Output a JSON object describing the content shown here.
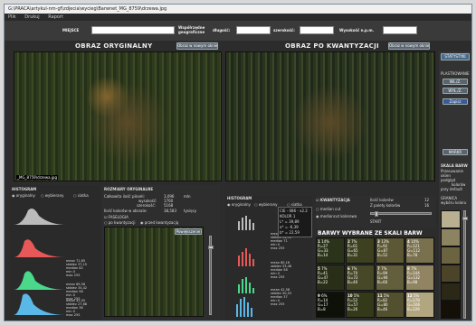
{
  "titlebar": {
    "path": "G:\\PRACA\\artykul-nm-gf\\zdjecia\\wycieg\\Barwnet_MG_8759\\drzewa.jpg"
  },
  "menu": [
    "Plik",
    "Drukuj",
    "Raport"
  ],
  "fields": {
    "miejsce_label": "MIEJSCE",
    "wsp_label": "Współrzędne geograficzne",
    "dlugosc_label": "długość:",
    "szerokosc_label": "szerokość:",
    "wysokosc_label": "Wysokość n.p.m."
  },
  "headers": {
    "original": "OBRAZ ORYGINALNY",
    "quantized": "OBRAZ PO KWANTYZACJI"
  },
  "buttons": {
    "open_original": "Obraz w nowym oknie",
    "open_quantized": "Obraz w nowym oknie",
    "statistics": "STATYSTYKI",
    "plastrowanie": "PLASTROWANIE",
    "wl_z": "WŁ./Z.",
    "wyl_z": "WYŁ./Z.",
    "clear": "Zapisz",
    "marker": "MARKR",
    "zoom": "Powiększenie"
  },
  "image_caption": "_MG_8759\\drzewa.jpg",
  "histogram": {
    "title": "HISTOGRAM",
    "options": [
      "oryginalny",
      "wybierany",
      "siatka"
    ],
    "stats_labels": [
      "mean",
      "stddev",
      "median",
      "min",
      "max"
    ],
    "stats_1": [
      "71,65",
      "37,15",
      "62",
      "0",
      "255"
    ],
    "stats_2": [
      "69,58",
      "34,42",
      "58",
      "0",
      "255"
    ],
    "stats_3": [
      "42,05",
      "27,68",
      "36",
      "0",
      "255"
    ]
  },
  "sizes": {
    "title": "ROZMIARY ORYGINALNE",
    "total_label": "Całkowita ilość pikseli:",
    "total_value": "3,096",
    "total_unit": "mln",
    "height_label": "wysokość:",
    "height_value": "1760",
    "width_label": "szerokość:",
    "width_value": "5168",
    "colors_label": "Ilość kolorów w obrazie:",
    "colors_value": "38,583",
    "colors_unit": "tysięcy",
    "fasel_label": "FASELOGIA",
    "fasel_opt1": "po kwantyzacji",
    "fasel_opt2": "przed kwantyzacją"
  },
  "histogram2": {
    "title": "HISTOGRAM",
    "options": [
      "oryginalny",
      "wybierany",
      "siatka"
    ],
    "stats_1": [
      "70,44",
      "34,94",
      "71",
      "0",
      "255"
    ],
    "stats_2": [
      "60,16",
      "33,48",
      "58",
      "0",
      "255"
    ],
    "stats_3": [
      "42,58",
      "30,53",
      "37",
      "0",
      "255"
    ]
  },
  "cie": {
    "title": "CIE - 086 - x2.2",
    "color": "KOLOR 1",
    "l": "L* = 39,89",
    "a": "a* = -6,39",
    "b": "b* = 22,59"
  },
  "quant": {
    "title": "KWANTYZACJA",
    "count_label": "Ilość kolorów",
    "count_value": "12",
    "scale_label": "Z palety kolorów",
    "scale_value": "16",
    "median_cut": "median cut",
    "median_lab": "mediancut kolorowa",
    "start": "START"
  },
  "barwy": {
    "title": "BARWY WYBRANE ZE SKALI BARW",
    "cells": [
      {
        "n": "1",
        "p": "14%",
        "r": "R=27",
        "g": "G=33",
        "b": "B=14",
        "color": "#2b331a"
      },
      {
        "n": "2",
        "p": "7%",
        "r": "R=61",
        "g": "G=65",
        "b": "B=31",
        "color": "#3d4120"
      },
      {
        "n": "3",
        "p": "13%",
        "r": "R=92",
        "g": "G=87",
        "b": "B=52",
        "color": "#5c5734"
      },
      {
        "n": "4",
        "p": "10%",
        "r": "R=121",
        "g": "G=112",
        "b": "B=78",
        "color": "#79704e"
      },
      {
        "n": "5",
        "p": "7%",
        "r": "R=41",
        "g": "G=47",
        "b": "B=22",
        "color": "#292f16"
      },
      {
        "n": "6",
        "p": "7%",
        "r": "R=70",
        "g": "G=72",
        "b": "B=40",
        "color": "#464828"
      },
      {
        "n": "7",
        "p": "7%",
        "r": "R=99",
        "g": "G=94",
        "b": "B=60",
        "color": "#635e3c"
      },
      {
        "n": "8",
        "p": "7%",
        "r": "R=144",
        "g": "G=132",
        "b": "B=98",
        "color": "#908462"
      },
      {
        "n": "9",
        "p": "6%",
        "r": "R=14",
        "g": "G=17",
        "b": "B=8",
        "color": "#0e1108"
      },
      {
        "n": "10",
        "p": "5%",
        "r": "R=52",
        "g": "G=57",
        "b": "B=26",
        "color": "#34391a"
      },
      {
        "n": "11",
        "p": "5%",
        "r": "R=82",
        "g": "G=80",
        "b": "B=46",
        "color": "#52502e"
      },
      {
        "n": "12",
        "p": "5%",
        "r": "R=178",
        "g": "G=166",
        "b": "B=129",
        "color": "#b2a681"
      }
    ]
  },
  "skala": {
    "title": "SKALA BARW",
    "sub1": "Przesuwanie",
    "sub2": "okien",
    "sub3": "podgląd",
    "sub4": "kolorów",
    "defaults": "przy default",
    "gamut": "GRANICA",
    "gamut2": "wybóru koloru",
    "swatches": [
      "#b8b090",
      "#8c8460",
      "#6c6440",
      "#4c4428",
      "#2c2818",
      "#141008"
    ]
  }
}
